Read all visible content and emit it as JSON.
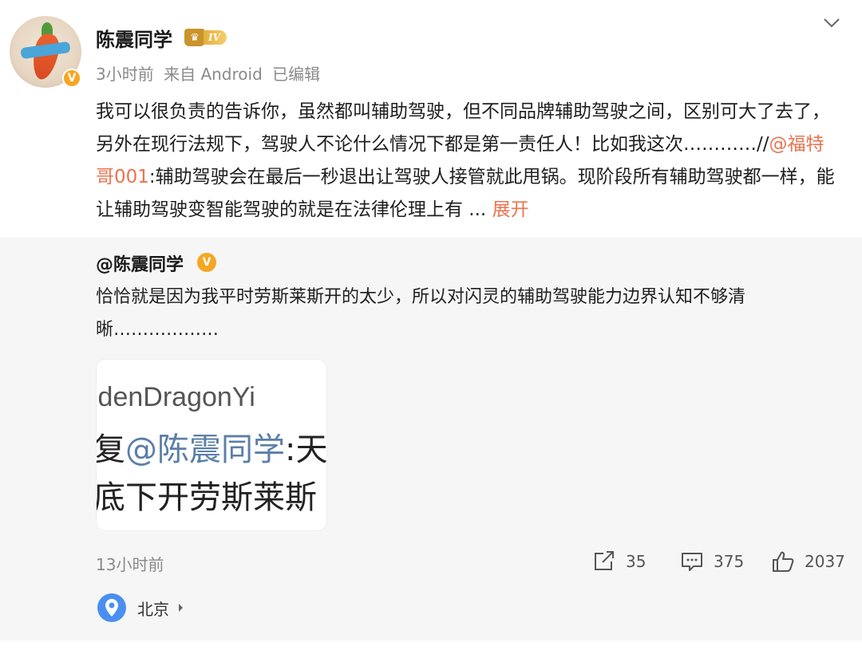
{
  "post": {
    "username": "陈震同学",
    "level_badge": "IV",
    "meta": {
      "time": "3小时前",
      "source": "来自 Android",
      "edited": "已编辑"
    },
    "text": {
      "part1": "我可以很负责的告诉你，虽然都叫辅助驾驶，但不同品牌辅助驾驶之间，区别可大了去了，另外在现行法规下，驾驶人不论什么情况下都是第一责任人！比如我这次…………//",
      "mention": "@福特哥001",
      "part2": ":辅助驾驶会在最后一秒退出让驾驶人接管就此甩锅。现阶段所有辅助驾驶都一样，能让辅助驾驶变智能驾驶的就是在法律伦理上有 ... ",
      "expand": "展开"
    },
    "verified_badge": "V"
  },
  "quoted": {
    "username": "@陈震同学",
    "verified_badge": "V",
    "text": "恰恰就是因为我平时劳斯莱斯开的太少，所以对闪灵的辅助驾驶能力边界认知不够清晰………………",
    "image_text": {
      "line1": "ldenDragonYi",
      "line2_prefix": "复",
      "line2_mention": "@陈震同学",
      "line2_suffix": ":天",
      "line3": "底下开劳斯莱斯"
    },
    "time": "13小时前",
    "actions": {
      "share_count": "35",
      "comment_count": "375",
      "like_count": "2037"
    },
    "location": "北京"
  },
  "colors": {
    "mention": "#eb7350",
    "badge": "#f5a623",
    "location_icon": "#4a8ff0"
  }
}
